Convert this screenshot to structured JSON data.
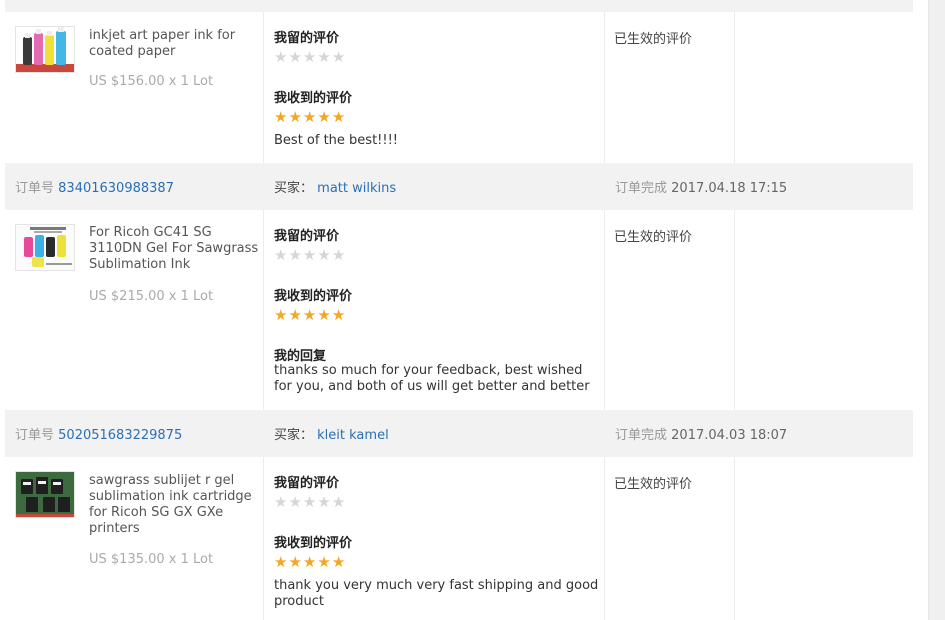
{
  "ui": {
    "my_review_label": "我留的评价",
    "received_review_label": "我收到的评价",
    "my_reply_label": "我的回复",
    "status_label": "已生效的评价",
    "order_prefix": "订单号",
    "buyer_prefix": "买家：",
    "completed_prefix": "订单完成"
  },
  "items": [
    {
      "product_name": "inkjet art paper ink for coated paper",
      "price": "US $156.00 x 1 Lot",
      "my_rating": 0,
      "received_rating": 5,
      "received_text": "Best of the best!!!!"
    },
    {
      "order_no": "83401630988387",
      "buyer": "matt wilkins",
      "completed": "2017.04.18 17:15",
      "product_name": "For Ricoh GC41 SG 3110DN Gel For Sawgrass Sublimation Ink",
      "price": "US $215.00 x 1 Lot",
      "my_rating": 0,
      "received_rating": 5,
      "reply_text": "thanks so much for your feedback, best wished for you, and both of us will get better and better"
    },
    {
      "order_no": "502051683229875",
      "buyer": "kleit kamel",
      "completed": "2017.04.03 18:07",
      "product_name": "sawgrass sublijet r gel sublimation ink cartridge for Ricoh SG GX GXe printers",
      "price": "US $135.00 x 1 Lot",
      "my_rating": 0,
      "received_rating": 5,
      "received_text": "thank you very much very fast shipping and good product"
    }
  ],
  "colors": {
    "star_on": "#f5a623",
    "star_off": "#d6d6d6",
    "link": "#2a6fb4",
    "band": "#f2f2f2"
  }
}
